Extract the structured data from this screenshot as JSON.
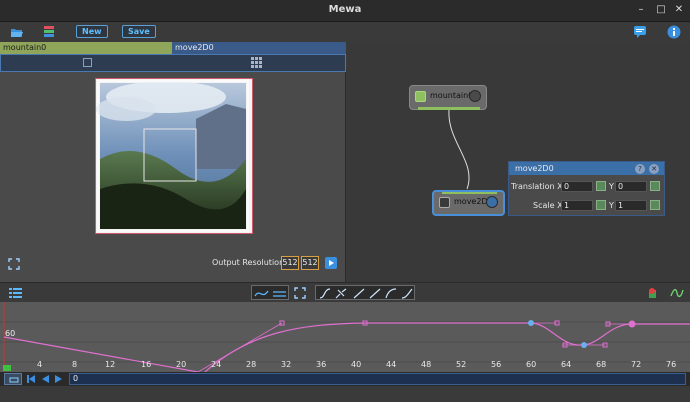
{
  "window": {
    "title": "Mewa"
  },
  "toolbar": {
    "new_label": "New",
    "save_label": "Save"
  },
  "viewer": {
    "tabs": [
      {
        "label": "mountain0"
      },
      {
        "label": "move2D0"
      }
    ],
    "output_resolution_label": "Output Resolution:",
    "res_w": "512",
    "res_h": "512"
  },
  "graph": {
    "nodes": [
      {
        "label": "mountain0"
      },
      {
        "label": "move2D0"
      }
    ],
    "props": {
      "title": "move2D0",
      "help": "?",
      "close": "✕",
      "translation_label": "Translation X",
      "tx": "0",
      "y_label": "Y",
      "ty": "0",
      "scale_label": "Scale X",
      "sx": "1",
      "sy": "1"
    }
  },
  "timeline": {
    "value_label": "60",
    "ticks": [
      "4",
      "8",
      "12",
      "16",
      "20",
      "24",
      "28",
      "32",
      "36",
      "40",
      "44",
      "48",
      "52",
      "56",
      "60",
      "64",
      "68",
      "72",
      "76"
    ],
    "frame_value": "0"
  },
  "colors": {
    "accent": "#5cc0ff",
    "curve": "#e070d0",
    "node_active": "#4a90d8",
    "node_green": "#8fc060"
  }
}
